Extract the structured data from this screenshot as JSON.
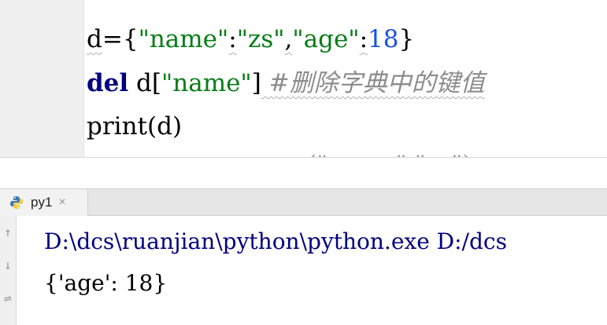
{
  "editor": {
    "line1": {
      "var": "d",
      "eq_brace": "={",
      "key1": "\"name\"",
      "colon1": ":",
      "val1": "\"zs\"",
      "comma": ",",
      "key2": "\"age\"",
      "colon2": ":",
      "num": "18",
      "close": "}"
    },
    "line2": {
      "kw": "del",
      "expr_pre": " d[",
      "key": "\"name\"",
      "expr_post": "]",
      "comment": " #删除字典中的键值"
    },
    "line3": {
      "text": "print(d)"
    },
    "line4_partial": "(\"name\",\"zs\")"
  },
  "run_panel": {
    "tab": {
      "label": "py1",
      "close": "×",
      "icon": "python-icon"
    },
    "toolbar": {
      "up": "↑",
      "down": "↓",
      "wrap": "⇌"
    },
    "console": {
      "line1": "D:\\dcs\\ruanjian\\python\\python.exe D:/dcs",
      "line2": "{'age': 18}"
    }
  },
  "colors": {
    "string": "#067d17",
    "number": "#1750eb",
    "keyword": "#000080",
    "comment": "#8c8c8c",
    "console_cmd": "#000080"
  }
}
